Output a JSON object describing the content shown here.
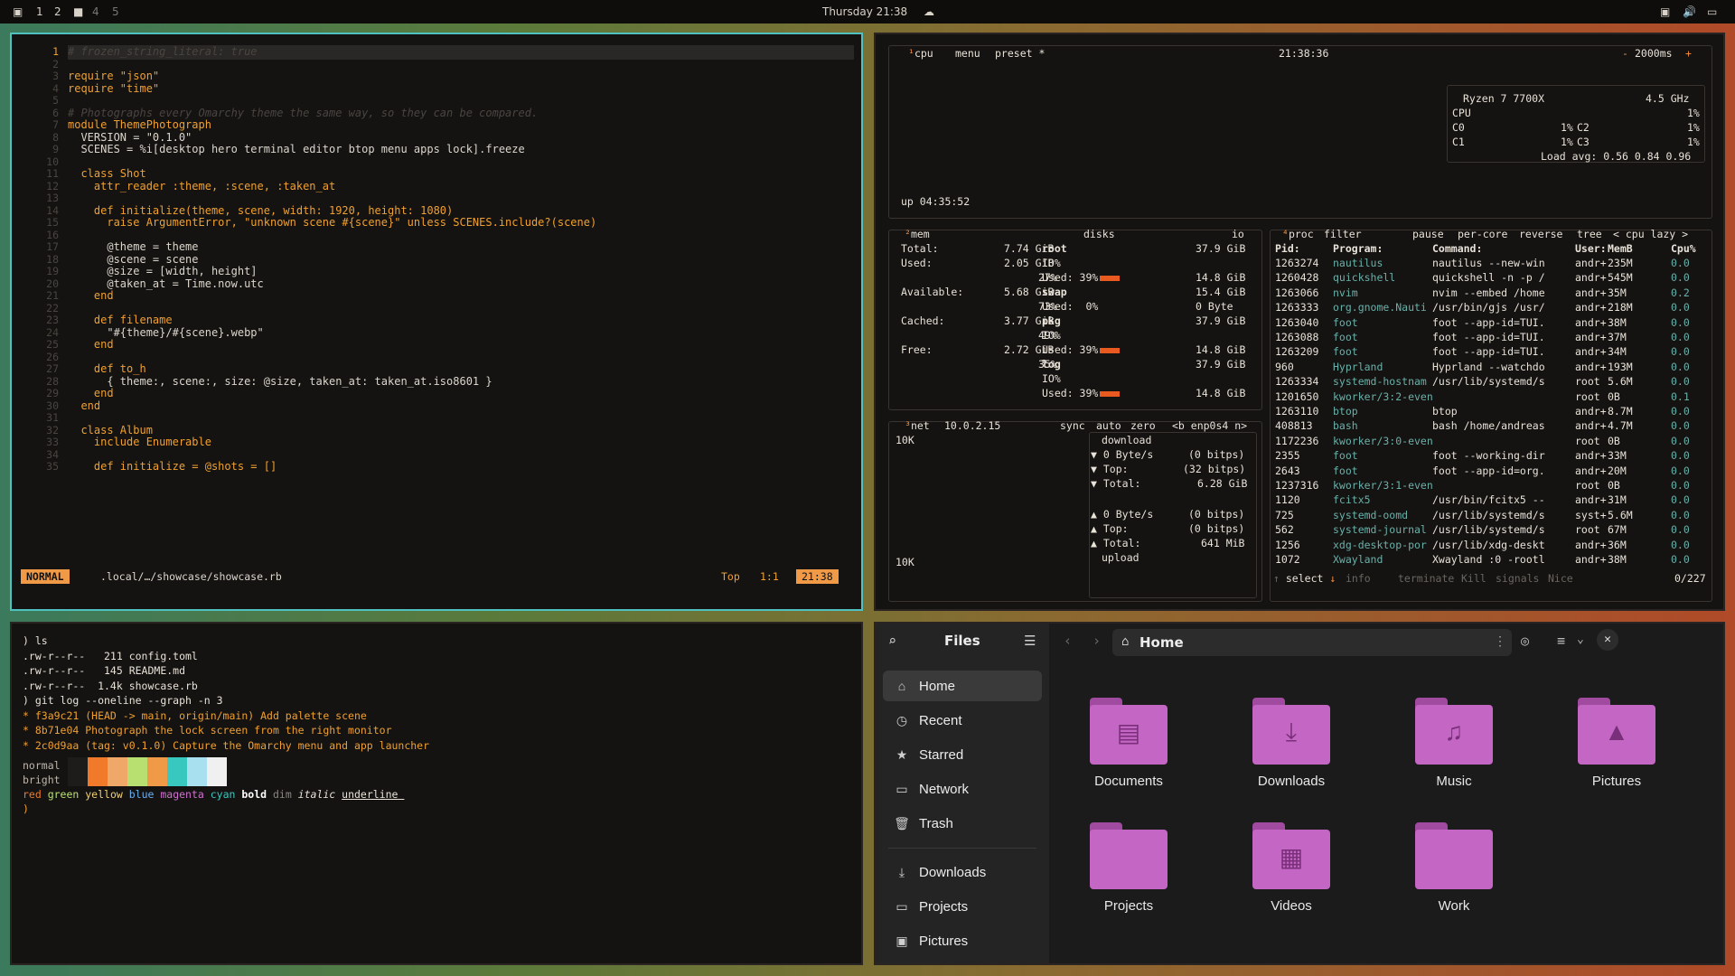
{
  "topbar": {
    "workspaces": [
      "1",
      "2",
      "4",
      "5"
    ],
    "clock": "Thursday 21:38"
  },
  "editor": {
    "lines": [
      {
        "n": "1",
        "t": "# frozen_string_literal: true"
      },
      {
        "n": "2",
        "t": ""
      },
      {
        "n": "3",
        "t": "require \"json\""
      },
      {
        "n": "4",
        "t": "require \"time\""
      },
      {
        "n": "5",
        "t": ""
      },
      {
        "n": "6",
        "t": "# Photographs every Omarchy theme the same way, so they can be compared."
      },
      {
        "n": "7",
        "t": "module ThemePhotograph"
      },
      {
        "n": "8",
        "t": "  VERSION = \"0.1.0\""
      },
      {
        "n": "9",
        "t": "  SCENES = %i[desktop hero terminal editor btop menu apps lock].freeze"
      },
      {
        "n": "10",
        "t": ""
      },
      {
        "n": "11",
        "t": "  class Shot"
      },
      {
        "n": "12",
        "t": "    attr_reader :theme, :scene, :taken_at"
      },
      {
        "n": "13",
        "t": ""
      },
      {
        "n": "14",
        "t": "    def initialize(theme, scene, width: 1920, height: 1080)"
      },
      {
        "n": "15",
        "t": "      raise ArgumentError, \"unknown scene #{scene}\" unless SCENES.include?(scene)"
      },
      {
        "n": "16",
        "t": ""
      },
      {
        "n": "17",
        "t": "      @theme = theme"
      },
      {
        "n": "18",
        "t": "      @scene = scene"
      },
      {
        "n": "19",
        "t": "      @size = [width, height]"
      },
      {
        "n": "20",
        "t": "      @taken_at = Time.now.utc"
      },
      {
        "n": "21",
        "t": "    end"
      },
      {
        "n": "22",
        "t": ""
      },
      {
        "n": "23",
        "t": "    def filename"
      },
      {
        "n": "24",
        "t": "      \"#{theme}/#{scene}.webp\""
      },
      {
        "n": "25",
        "t": "    end"
      },
      {
        "n": "26",
        "t": ""
      },
      {
        "n": "27",
        "t": "    def to_h"
      },
      {
        "n": "28",
        "t": "      { theme:, scene:, size: @size, taken_at: taken_at.iso8601 }"
      },
      {
        "n": "29",
        "t": "    end"
      },
      {
        "n": "30",
        "t": "  end"
      },
      {
        "n": "31",
        "t": ""
      },
      {
        "n": "32",
        "t": "  class Album"
      },
      {
        "n": "33",
        "t": "    include Enumerable"
      },
      {
        "n": "34",
        "t": ""
      },
      {
        "n": "35",
        "t": "    def initialize = @shots = []"
      }
    ],
    "status": {
      "mode": "NORMAL",
      "path": ".local/…/showcase/showcase.rb",
      "pos": "Top",
      "cursor": "1:1",
      "time": "21:38"
    }
  },
  "btop": {
    "cpu": {
      "tab": "cpu",
      "menu": "menu",
      "preset": "preset *",
      "time": "21:38:36",
      "interval": "2000ms",
      "model": "Ryzen 7 7700X",
      "freq": "4.5 GHz",
      "total": "1%",
      "cores": [
        [
          "C0",
          "1%"
        ],
        [
          "C1",
          "1%"
        ],
        [
          "C2",
          "1%"
        ],
        [
          "C3",
          "1%"
        ]
      ],
      "load": "Load avg: 0.56 0.84 0.96",
      "uptime": "up 04:35:52"
    },
    "mem": {
      "title": "mem",
      "total": "7.74 GiB",
      "used": "2.05 GiB",
      "used_pct": "27%",
      "avail": "5.68 GiB",
      "avail_pct": "73%",
      "cached": "3.77 GiB",
      "cached_pct": "49%",
      "free": "2.72 GiB",
      "free_pct": "35%"
    },
    "disks": {
      "title": "disks",
      "io": "io",
      "rows": [
        [
          "root",
          "37.9 GiB"
        ],
        [
          "IO%",
          ""
        ],
        [
          "Used: 39%",
          "14.8 GiB"
        ],
        [
          "swap",
          "15.4 GiB"
        ],
        [
          "Used:  0%",
          "0 Byte"
        ],
        [
          "pkg",
          "37.9 GiB"
        ],
        [
          "IO%",
          ""
        ],
        [
          "Used: 39%",
          "14.8 GiB"
        ],
        [
          "log",
          "37.9 GiB"
        ],
        [
          "IO%",
          ""
        ],
        [
          "Used: 39%",
          "14.8 GiB"
        ]
      ]
    },
    "net": {
      "title": "net",
      "ip": "10.0.2.15",
      "sync": "sync",
      "auto": "auto",
      "zero": "zero",
      "iface": "<b enp0s4 n>",
      "scale_top": "10K",
      "scale_bot": "10K",
      "download": {
        "label": "download",
        "rate": "0 Byte/s",
        "rate_b": "(0 bitps)",
        "top": "Top:",
        "top_b": "(32 bitps)",
        "total": "Total:",
        "total_v": "6.28 GiB"
      },
      "upload": {
        "label": "upload",
        "rate": "0 Byte/s",
        "rate_b": "(0 bitps)",
        "top": "Top:",
        "top_b": "(0 bitps)",
        "total": "Total:",
        "total_v": "641 MiB"
      }
    },
    "proc": {
      "title": "proc",
      "filter": "filter",
      "pause": "pause",
      "percore": "per-core",
      "reverse": "reverse",
      "tree": "tree",
      "sort": "< cpu lazy >",
      "headers": [
        "Pid:",
        "Program:",
        "Command:",
        "User:",
        "MemB",
        "Cpu%"
      ],
      "rows": [
        [
          "1263274",
          "nautilus",
          "nautilus --new-win",
          "andr+",
          "235M",
          "0.0"
        ],
        [
          "1260428",
          "quickshell",
          "quickshell -n -p /",
          "andr+",
          "545M",
          "0.0"
        ],
        [
          "1263066",
          "nvim",
          "nvim --embed /home",
          "andr+",
          "35M",
          "0.2"
        ],
        [
          "1263333",
          "org.gnome.Nauti",
          "/usr/bin/gjs /usr/",
          "andr+",
          "218M",
          "0.0"
        ],
        [
          "1263040",
          "foot",
          "foot --app-id=TUI.",
          "andr+",
          "38M",
          "0.0"
        ],
        [
          "1263088",
          "foot",
          "foot --app-id=TUI.",
          "andr+",
          "37M",
          "0.0"
        ],
        [
          "1263209",
          "foot",
          "foot --app-id=TUI.",
          "andr+",
          "34M",
          "0.0"
        ],
        [
          "960",
          "Hyprland",
          "Hyprland --watchdo",
          "andr+",
          "193M",
          "0.0"
        ],
        [
          "1263334",
          "systemd-hostnam",
          "/usr/lib/systemd/s",
          "root",
          "5.6M",
          "0.0"
        ],
        [
          "1201650",
          "kworker/3:2-even",
          "",
          "root",
          "0B",
          "0.1"
        ],
        [
          "1263110",
          "btop",
          "btop",
          "andr+",
          "8.7M",
          "0.0"
        ],
        [
          "408813",
          "bash",
          "bash /home/andreas",
          "andr+",
          "4.7M",
          "0.0"
        ],
        [
          "1172236",
          "kworker/3:0-even",
          "",
          "root",
          "0B",
          "0.0"
        ],
        [
          "2355",
          "foot",
          "foot --working-dir",
          "andr+",
          "33M",
          "0.0"
        ],
        [
          "2643",
          "foot",
          "foot --app-id=org.",
          "andr+",
          "20M",
          "0.0"
        ],
        [
          "1237316",
          "kworker/3:1-even",
          "",
          "root",
          "0B",
          "0.0"
        ],
        [
          "1120",
          "fcitx5",
          "/usr/bin/fcitx5 --",
          "andr+",
          "31M",
          "0.0"
        ],
        [
          "725",
          "systemd-oomd",
          "/usr/lib/systemd/s",
          "syst+",
          "5.6M",
          "0.0"
        ],
        [
          "562",
          "systemd-journal",
          "/usr/lib/systemd/s",
          "root",
          "67M",
          "0.0"
        ],
        [
          "1256",
          "xdg-desktop-por",
          "/usr/lib/xdg-deskt",
          "andr+",
          "36M",
          "0.0"
        ],
        [
          "1072",
          "Xwayland",
          "Xwayland :0 -rootl",
          "andr+",
          "38M",
          "0.0"
        ]
      ],
      "footer": {
        "select": "select",
        "info": "info",
        "terminate": "terminate",
        "kill": "Kill",
        "signals": "signals",
        "nice": "Nice",
        "count": "0/227"
      }
    }
  },
  "terminal": {
    "lines": [
      ") ls",
      ".rw-r--r--   211 config.toml",
      ".rw-r--r--   145 README.md",
      ".rw-r--r--  1.4k showcase.rb",
      ") git log --oneline --graph -n 3",
      "* f3a9c21 (HEAD -> main, origin/main) Add palette scene",
      "* 8b71e04 Photograph the lock screen from the right monitor",
      "* 2c0d9aa (tag: v0.1.0) Capture the Omarchy menu and app launcher"
    ],
    "normal": "normal",
    "bright": "bright",
    "normal_colors": [
      "#1e1c1a",
      "#f07a2a",
      "#f0a868",
      "#b8e070",
      "#f09a48",
      "#38c8c0",
      "#a8e0f0",
      "#f0f0f0"
    ],
    "bright_colors": [
      "#1e1c1a",
      "#f07a2a",
      "#f0a868",
      "#b8e070",
      "#f09a48",
      "#38c8c0",
      "#a8e0f0",
      "#f0f0f0"
    ],
    "styles": [
      "red",
      "green",
      "yellow",
      "blue",
      "magenta",
      "cyan",
      "bold",
      "dim",
      "italic",
      "underline"
    ],
    "prompt": ")"
  },
  "files": {
    "title": "Files",
    "location": "Home",
    "sidebar": [
      {
        "label": "Home",
        "icon": "home-icon"
      },
      {
        "label": "Recent",
        "icon": "clock-icon"
      },
      {
        "label": "Starred",
        "icon": "star-icon"
      },
      {
        "label": "Network",
        "icon": "network-icon"
      },
      {
        "label": "Trash",
        "icon": "trash-icon"
      }
    ],
    "bookmarks": [
      {
        "label": "Downloads",
        "icon": "download-icon"
      },
      {
        "label": "Projects",
        "icon": "folder-icon"
      },
      {
        "label": "Pictures",
        "icon": "picture-icon"
      }
    ],
    "folders": [
      {
        "label": "Documents",
        "glyph": "▤"
      },
      {
        "label": "Downloads",
        "glyph": "⤓"
      },
      {
        "label": "Music",
        "glyph": "♫"
      },
      {
        "label": "Pictures",
        "glyph": "▲"
      },
      {
        "label": "Projects",
        "glyph": ""
      },
      {
        "label": "Videos",
        "glyph": "▦"
      },
      {
        "label": "Work",
        "glyph": ""
      }
    ],
    "accent": "#c466c4"
  }
}
